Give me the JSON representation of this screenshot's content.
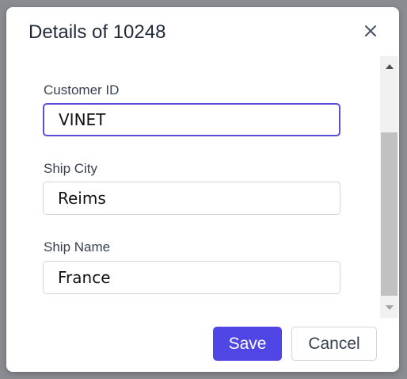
{
  "dialog": {
    "title": "Details of 10248",
    "fields": [
      {
        "label": "Customer ID",
        "value": "VINET"
      },
      {
        "label": "Ship City",
        "value": "Reims"
      },
      {
        "label": "Ship Name",
        "value": "France"
      }
    ],
    "buttons": {
      "save_label": "Save",
      "cancel_label": "Cancel"
    }
  },
  "colors": {
    "accent": "#4f46e5",
    "focus_border": "#5a4fd6"
  },
  "icons": {
    "close": "close-icon",
    "scroll_up": "scroll-up-arrow-icon",
    "scroll_down": "scroll-down-arrow-icon"
  }
}
